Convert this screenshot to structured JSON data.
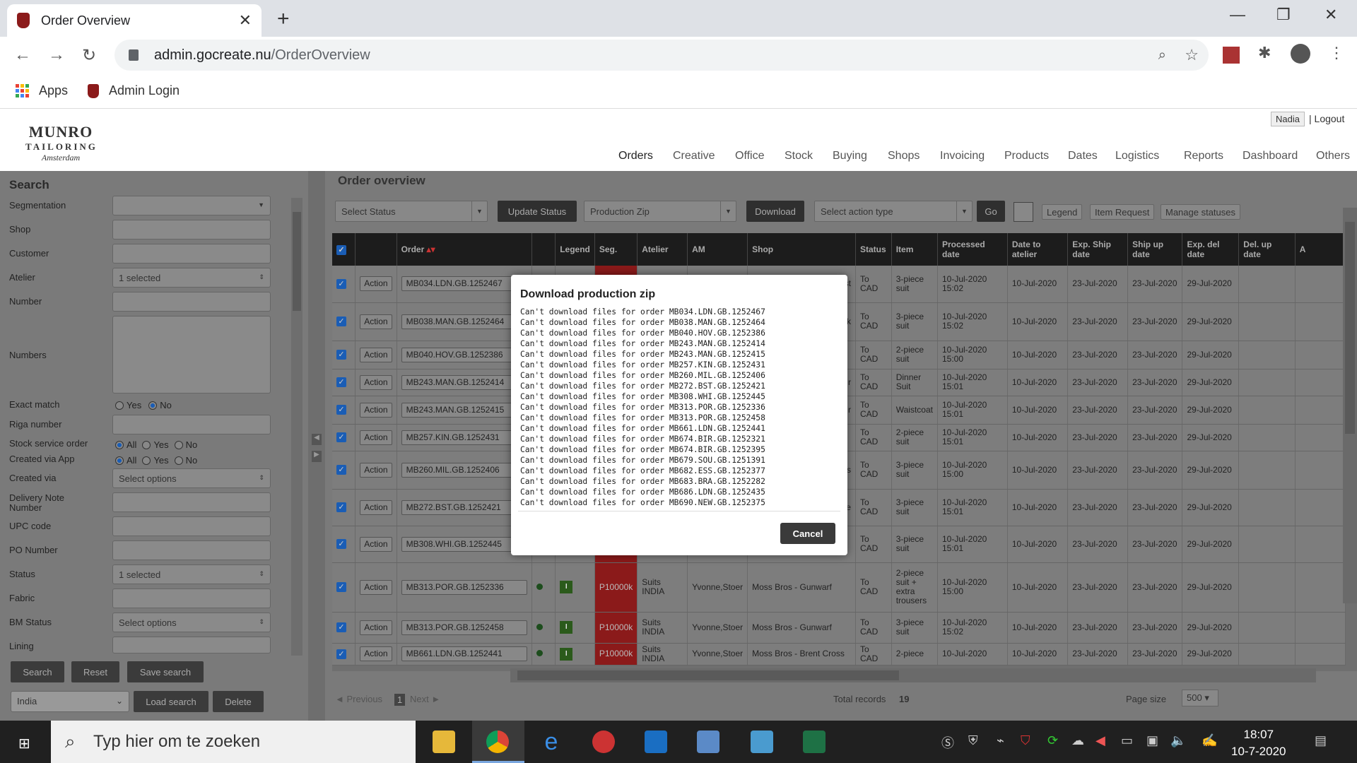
{
  "browser": {
    "tab_title": "Order Overview",
    "url_host": "admin.gocreate.nu",
    "url_path": "/OrderOverview",
    "bookmarks": [
      "Apps",
      "Admin Login"
    ]
  },
  "header": {
    "logo_line1": "MUNRO",
    "logo_line2": "TAILORING",
    "logo_line3": "Amsterdam",
    "user": "Nadia",
    "logout": "| Logout",
    "nav": [
      "Orders",
      "Creative",
      "Office",
      "Stock",
      "Buying",
      "Shops",
      "Invoicing",
      "Products",
      "Dates",
      "Logistics",
      "Reports",
      "Dashboard",
      "Others"
    ]
  },
  "search": {
    "title": "Search",
    "labels": {
      "segmentation": "Segmentation",
      "shop": "Shop",
      "customer": "Customer",
      "atelier": "Atelier",
      "number": "Number",
      "numbers": "Numbers",
      "exact_match": "Exact match",
      "riga": "Riga number",
      "stock_service": "Stock service order",
      "created_app": "Created via App",
      "created_via": "Created via",
      "delivery_note": "Delivery Note Number",
      "upc": "UPC code",
      "po": "PO Number",
      "status": "Status",
      "fabric": "Fabric",
      "bm_status": "BM Status",
      "lining": "Lining"
    },
    "values": {
      "atelier": "1 selected",
      "created_via": "Select options",
      "status": "1 selected",
      "bm_status": "Select options"
    },
    "radio": {
      "yes": "Yes",
      "no": "No",
      "all": "All"
    },
    "buttons": {
      "search": "Search",
      "reset": "Reset",
      "save_search": "Save search",
      "load_search": "Load search",
      "delete": "Delete"
    },
    "saved_select": "India"
  },
  "overview": {
    "title": "Order overview",
    "select_status": "Select Status",
    "update_status": "Update Status",
    "production_zip": "Production Zip",
    "download": "Download",
    "select_action": "Select action type",
    "go": "Go",
    "legend": "Legend",
    "item_request": "Item Request",
    "manage_statuses": "Manage statuses",
    "columns": [
      "Order",
      "Legend",
      "Seg.",
      "Atelier",
      "AM",
      "Shop",
      "Status",
      "Item",
      "Processed date",
      "Date to atelier",
      "Exp. Ship date",
      "Ship up date",
      "Exp. del date",
      "Del. up date",
      "A"
    ],
    "rows": [
      {
        "order": "MB034.LDN.GB.1252467",
        "shop_tail": "Vest",
        "status": "To CAD",
        "item": "3-piece suit",
        "processed": "10-Jul-2020 15:02",
        "to_atelier": "10-Jul-2020",
        "exp_ship": "23-Jul-2020",
        "ship_up": "23-Jul-2020",
        "exp_del": "29-Jul-2020"
      },
      {
        "order": "MB038.MAN.GB.1252464",
        "shop_tail": "rk",
        "status": "To CAD",
        "item": "3-piece suit",
        "processed": "10-Jul-2020 15:02",
        "to_atelier": "10-Jul-2020",
        "exp_ship": "23-Jul-2020",
        "ship_up": "23-Jul-2020",
        "exp_del": "29-Jul-2020"
      },
      {
        "order": "MB040.HOV.GB.1252386",
        "shop_tail": "",
        "status": "To CAD",
        "item": "2-piece suit",
        "processed": "10-Jul-2020 15:00",
        "to_atelier": "10-Jul-2020",
        "exp_ship": "23-Jul-2020",
        "ship_up": "23-Jul-2020",
        "exp_del": "29-Jul-2020"
      },
      {
        "order": "MB243.MAN.GB.1252414",
        "shop_tail": "r",
        "status": "To CAD",
        "item": "Dinner Suit",
        "processed": "10-Jul-2020 15:01",
        "to_atelier": "10-Jul-2020",
        "exp_ship": "23-Jul-2020",
        "ship_up": "23-Jul-2020",
        "exp_del": "29-Jul-2020"
      },
      {
        "order": "MB243.MAN.GB.1252415",
        "shop_tail": "r",
        "status": "To CAD",
        "item": "Waistcoat",
        "processed": "10-Jul-2020 15:01",
        "to_atelier": "10-Jul-2020",
        "exp_ship": "23-Jul-2020",
        "ship_up": "23-Jul-2020",
        "exp_del": "29-Jul-2020"
      },
      {
        "order": "MB257.KIN.GB.1252431",
        "shop_tail": "",
        "status": "To CAD",
        "item": "2-piece suit",
        "processed": "10-Jul-2020 15:01",
        "to_atelier": "10-Jul-2020",
        "exp_ship": "23-Jul-2020",
        "ship_up": "23-Jul-2020",
        "exp_del": "29-Jul-2020"
      },
      {
        "order": "MB260.MIL.GB.1252406",
        "shop_tail": "es",
        "status": "To CAD",
        "item": "3-piece suit",
        "processed": "10-Jul-2020 15:00",
        "to_atelier": "10-Jul-2020",
        "exp_ship": "23-Jul-2020",
        "ship_up": "23-Jul-2020",
        "exp_del": "29-Jul-2020"
      },
      {
        "order": "MB272.BST.GB.1252421",
        "shop_tail": "e",
        "status": "To CAD",
        "item": "3-piece suit",
        "processed": "10-Jul-2020 15:01",
        "to_atelier": "10-Jul-2020",
        "exp_ship": "23-Jul-2020",
        "ship_up": "23-Jul-2020",
        "exp_del": "29-Jul-2020"
      },
      {
        "order": "MB308.WHI.GB.1252445",
        "shop_tail": "",
        "status": "To CAD",
        "item": "3-piece suit",
        "processed": "10-Jul-2020 15:01",
        "to_atelier": "10-Jul-2020",
        "exp_ship": "23-Jul-2020",
        "ship_up": "23-Jul-2020",
        "exp_del": "29-Jul-2020"
      },
      {
        "order": "MB313.POR.GB.1252336",
        "seg": "P10000k",
        "atelier": "Suits INDIA",
        "am": "Yvonne,Stoer",
        "shop": "Moss Bros - Gunwarf",
        "status": "To CAD",
        "item": "2-piece suit + extra trousers",
        "processed": "10-Jul-2020 15:00",
        "to_atelier": "10-Jul-2020",
        "exp_ship": "23-Jul-2020",
        "ship_up": "23-Jul-2020",
        "exp_del": "29-Jul-2020"
      },
      {
        "order": "MB313.POR.GB.1252458",
        "seg": "P10000k",
        "atelier": "Suits INDIA",
        "am": "Yvonne,Stoer",
        "shop": "Moss Bros - Gunwarf",
        "status": "To CAD",
        "item": "3-piece suit",
        "processed": "10-Jul-2020 15:02",
        "to_atelier": "10-Jul-2020",
        "exp_ship": "23-Jul-2020",
        "ship_up": "23-Jul-2020",
        "exp_del": "29-Jul-2020"
      },
      {
        "order": "MB661.LDN.GB.1252441",
        "seg": "P10000k",
        "atelier": "Suits INDIA",
        "am": "Yvonne,Stoer",
        "shop": "Moss Bros - Brent Cross",
        "status": "To CAD",
        "item": "2-piece",
        "processed": "10-Jul-2020",
        "to_atelier": "10-Jul-2020",
        "exp_ship": "23-Jul-2020",
        "ship_up": "23-Jul-2020",
        "exp_del": "29-Jul-2020"
      }
    ],
    "action_label": "Action",
    "legend_letter": "I",
    "pager": {
      "previous": "◄ Previous",
      "page": "1",
      "next": "Next ►",
      "total_label": "Total records",
      "total": "19",
      "page_size_label": "Page size",
      "page_size": "500"
    }
  },
  "modal": {
    "title": "Download production zip",
    "cancel": "Cancel",
    "messages": [
      "Can't download files for order MB034.LDN.GB.1252467",
      "Can't download files for order MB038.MAN.GB.1252464",
      "Can't download files for order MB040.HOV.GB.1252386",
      "Can't download files for order MB243.MAN.GB.1252414",
      "Can't download files for order MB243.MAN.GB.1252415",
      "Can't download files for order MB257.KIN.GB.1252431",
      "Can't download files for order MB260.MIL.GB.1252406",
      "Can't download files for order MB272.BST.GB.1252421",
      "Can't download files for order MB308.WHI.GB.1252445",
      "Can't download files for order MB313.POR.GB.1252336",
      "Can't download files for order MB313.POR.GB.1252458",
      "Can't download files for order MB661.LDN.GB.1252441",
      "Can't download files for order MB674.BIR.GB.1252321",
      "Can't download files for order MB674.BIR.GB.1252395",
      "Can't download files for order MB679.SOU.GB.1251391",
      "Can't download files for order MB682.ESS.GB.1252377",
      "Can't download files for order MB683.BRA.GB.1252282",
      "Can't download files for order MB686.LDN.GB.1252435",
      "Can't download files for order MB690.NEW.GB.1252375"
    ]
  },
  "taskbar": {
    "search_placeholder": "Typ hier om te zoeken",
    "time": "18:07",
    "date": "10-7-2020"
  }
}
